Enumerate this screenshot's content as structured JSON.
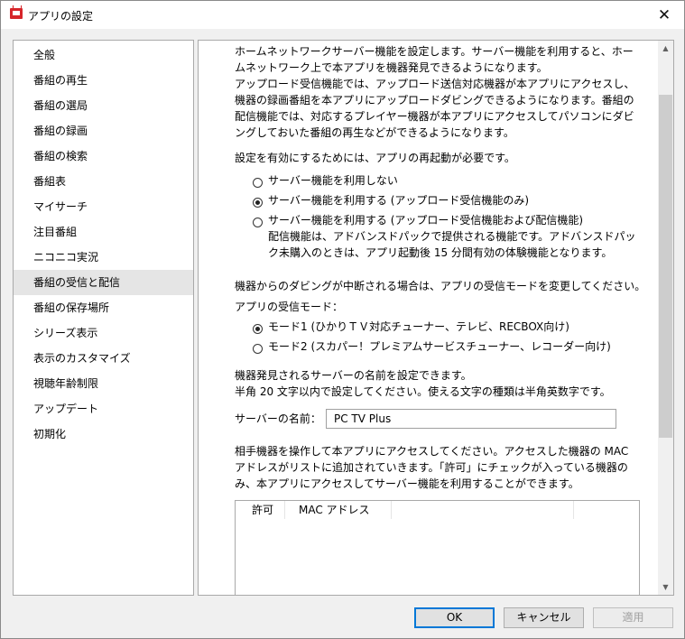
{
  "window": {
    "title": "アプリの設定",
    "close_glyph": "✕"
  },
  "sidebar": {
    "items": [
      {
        "label": "全般"
      },
      {
        "label": "番組の再生"
      },
      {
        "label": "番組の選局"
      },
      {
        "label": "番組の録画"
      },
      {
        "label": "番組の検索"
      },
      {
        "label": "番組表"
      },
      {
        "label": "マイサーチ"
      },
      {
        "label": "注目番組"
      },
      {
        "label": "ニコニコ実況"
      },
      {
        "label": "番組の受信と配信",
        "selected": true
      },
      {
        "label": "番組の保存場所"
      },
      {
        "label": "シリーズ表示"
      },
      {
        "label": "表示のカスタマイズ"
      },
      {
        "label": "視聴年齢制限"
      },
      {
        "label": "アップデート"
      },
      {
        "label": "初期化"
      }
    ]
  },
  "content": {
    "intro": [
      "ホームネットワークサーバー機能を設定します。サーバー機能を利用すると、ホー",
      "ムネットワーク上で本アプリを機器発見できるようになります。",
      "アップロード受信機能では、アップロード送信対応機器が本アプリにアクセスし、",
      "機器の録画番組を本アプリにアップロードダビングできるようになります。番組の",
      "配信機能では、対応するプレイヤー機器が本アプリにアクセスしてパソコンにダビ",
      "ングしておいた番組の再生などができるようになります。"
    ],
    "restart_note": "設定を有効にするためには、アプリの再起動が必要です。",
    "server_options": [
      {
        "label": "サーバー機能を利用しない",
        "selected": false
      },
      {
        "label": "サーバー機能を利用する (アップロード受信機能のみ)",
        "selected": true
      },
      {
        "label": "サーバー機能を利用する (アップロード受信機能および配信機能)",
        "selected": false
      }
    ],
    "delivery_note": [
      "配信機能は、アドバンスドパックで提供される機能です。アドバンスドパッ",
      "ク未購入のときは、アプリ起動後 15 分間有効の体験機能となります。"
    ],
    "dubbing_note": "機器からのダビングが中断される場合は、アプリの受信モードを変更してください。",
    "receive_mode_label": "アプリの受信モード：",
    "receive_modes": [
      {
        "label": "モード1 (ひかりＴＶ対応チューナー、テレビ、RECBOX向け)",
        "selected": true
      },
      {
        "label": "モード2 (スカパー！プレミアムサービスチューナー、レコーダー向け)",
        "selected": false
      }
    ],
    "name_note": [
      "機器発見されるサーバーの名前を設定できます。",
      "半角 20 文字以内で設定してください。使える文字の種類は半角英数字です。"
    ],
    "server_name_label": "サーバーの名前：",
    "server_name_value": "PC TV Plus",
    "mac_note": [
      "相手機器を操作して本アプリにアクセスしてください。アクセスした機器の MAC",
      "アドレスがリストに追加されていきます。「許可」にチェックが入っている機器の",
      "み、本アプリにアクセスしてサーバー機能を利用することができます。"
    ],
    "list_headers": {
      "allow": "許可",
      "mac": "MAC アドレス"
    }
  },
  "buttons": {
    "ok": "OK",
    "cancel": "キャンセル",
    "apply": "適用"
  }
}
